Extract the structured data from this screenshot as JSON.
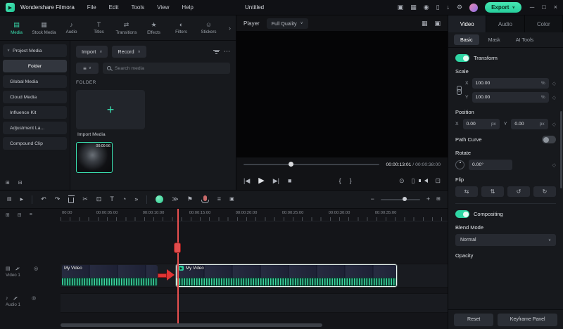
{
  "menubar": {
    "app_name": "Wondershare Filmora",
    "menus": [
      {
        "label": "File"
      },
      {
        "label": "Edit"
      },
      {
        "label": "Tools"
      },
      {
        "label": "View"
      },
      {
        "label": "Help"
      }
    ],
    "project_title": "Untitled",
    "export_label": "Export"
  },
  "media_tabs": {
    "items": [
      {
        "label": "Media"
      },
      {
        "label": "Stock Media"
      },
      {
        "label": "Audio"
      },
      {
        "label": "Titles"
      },
      {
        "label": "Transitions"
      },
      {
        "label": "Effects"
      },
      {
        "label": "Filters"
      },
      {
        "label": "Stickers"
      }
    ]
  },
  "sidebar": {
    "items": [
      {
        "label": "Project Media"
      },
      {
        "label": "Folder"
      },
      {
        "label": "Global Media"
      },
      {
        "label": "Cloud Media"
      },
      {
        "label": "Influence Kit"
      },
      {
        "label": "Adjustment La..."
      },
      {
        "label": "Compound Clip"
      }
    ]
  },
  "media_panel": {
    "import_label": "Import",
    "record_label": "Record",
    "search_placeholder": "Search media",
    "section_label": "FOLDER",
    "import_tile_label": "Import Media",
    "clip_duration": "00:00:56"
  },
  "player": {
    "label": "Player",
    "quality": "Full Quality",
    "current_time": "00:00:13:01",
    "separator": " / ",
    "total_time": "00:00:38:00"
  },
  "properties": {
    "tabs": [
      {
        "label": "Video"
      },
      {
        "label": "Audio"
      },
      {
        "label": "Color"
      }
    ],
    "subtabs": [
      {
        "label": "Basic"
      },
      {
        "label": "Mask"
      },
      {
        "label": "AI Tools"
      }
    ],
    "transform": {
      "label": "Transform"
    },
    "scale": {
      "label": "Scale",
      "x_label": "X",
      "x_value": "100.00",
      "x_unit": "%",
      "y_label": "Y",
      "y_value": "100.00",
      "y_unit": "%"
    },
    "position": {
      "label": "Position",
      "x_label": "X",
      "x_value": "0.00",
      "x_unit": "px",
      "y_label": "Y",
      "y_value": "0.00",
      "y_unit": "px"
    },
    "path_curve": {
      "label": "Path Curve"
    },
    "rotate": {
      "label": "Rotate",
      "value": "0.00°"
    },
    "flip": {
      "label": "Flip"
    },
    "compositing": {
      "label": "Compositing"
    },
    "blend_mode": {
      "label": "Blend Mode",
      "value": "Normal"
    },
    "opacity": {
      "label": "Opacity"
    },
    "footer": {
      "reset_label": "Reset",
      "keyframe_label": "Keyframe Panel"
    }
  },
  "timeline": {
    "ruler_labels": [
      "00:00",
      "00:00:05:00",
      "00:00:10:00",
      "00:00:15:00",
      "00:00:20:00",
      "00:00:25:00",
      "00:00:30:00",
      "00:00:35:00"
    ],
    "tracks": [
      {
        "name": "Video 1"
      },
      {
        "name": "Audio 1"
      }
    ],
    "clips": [
      {
        "label": "My Video"
      },
      {
        "label": "My Video"
      }
    ]
  },
  "colors": {
    "accent": "#3ae0b0",
    "playhead_red": "#e85050",
    "waveform_green": "#3bd8a1"
  },
  "icons": {
    "logo_play": "▶",
    "caret": "∨",
    "gift": "▣",
    "workspace": "▦",
    "screencast": "◉",
    "display": "▯",
    "download": "↓",
    "settings": "⚙",
    "minimize": "─",
    "maximize": "□",
    "close": "×",
    "tab_media": "▤",
    "tab_stock": "▦",
    "tab_audio": "♪",
    "tab_titles": "T",
    "tab_transitions": "⇄",
    "tab_effects": "★",
    "tab_filters": "◐",
    "tab_stickers": "☺",
    "tabs_more": "›",
    "more": "⋯",
    "multiview": "▦",
    "popout": "▣",
    "prev_frame": "|◀",
    "play": "▶",
    "next_frame": "▶|",
    "stop": "■",
    "mark_in": "{",
    "mark_out": "}",
    "snapshot": "⊙",
    "mirror": "▯",
    "fullscreen": "⊡",
    "tracks": "▤",
    "select": "▸",
    "undo": "↶",
    "redo": "↷",
    "split": "✂",
    "crop": "⊡",
    "text_tool": "T",
    "speed": "◔",
    "more_tools": "»",
    "render": "≫",
    "marker": "⚑",
    "mixer": "≡",
    "screen_rec": "▣",
    "zoom_out": "−",
    "zoom_in": "+",
    "fit": "⊞",
    "corner_add": "⊞",
    "corner_remove": "⊟",
    "corner_menu": "≡",
    "track_video": "▤",
    "track_audio": "♪",
    "mute": "♪",
    "eye": "◎",
    "folder_add": "⊞",
    "folder_remove": "⊟",
    "keyframe": "◇",
    "flip_h": "⇆",
    "flip_v": "⇅",
    "rotate_ccw": "↺",
    "rotate_cw": "↻"
  }
}
